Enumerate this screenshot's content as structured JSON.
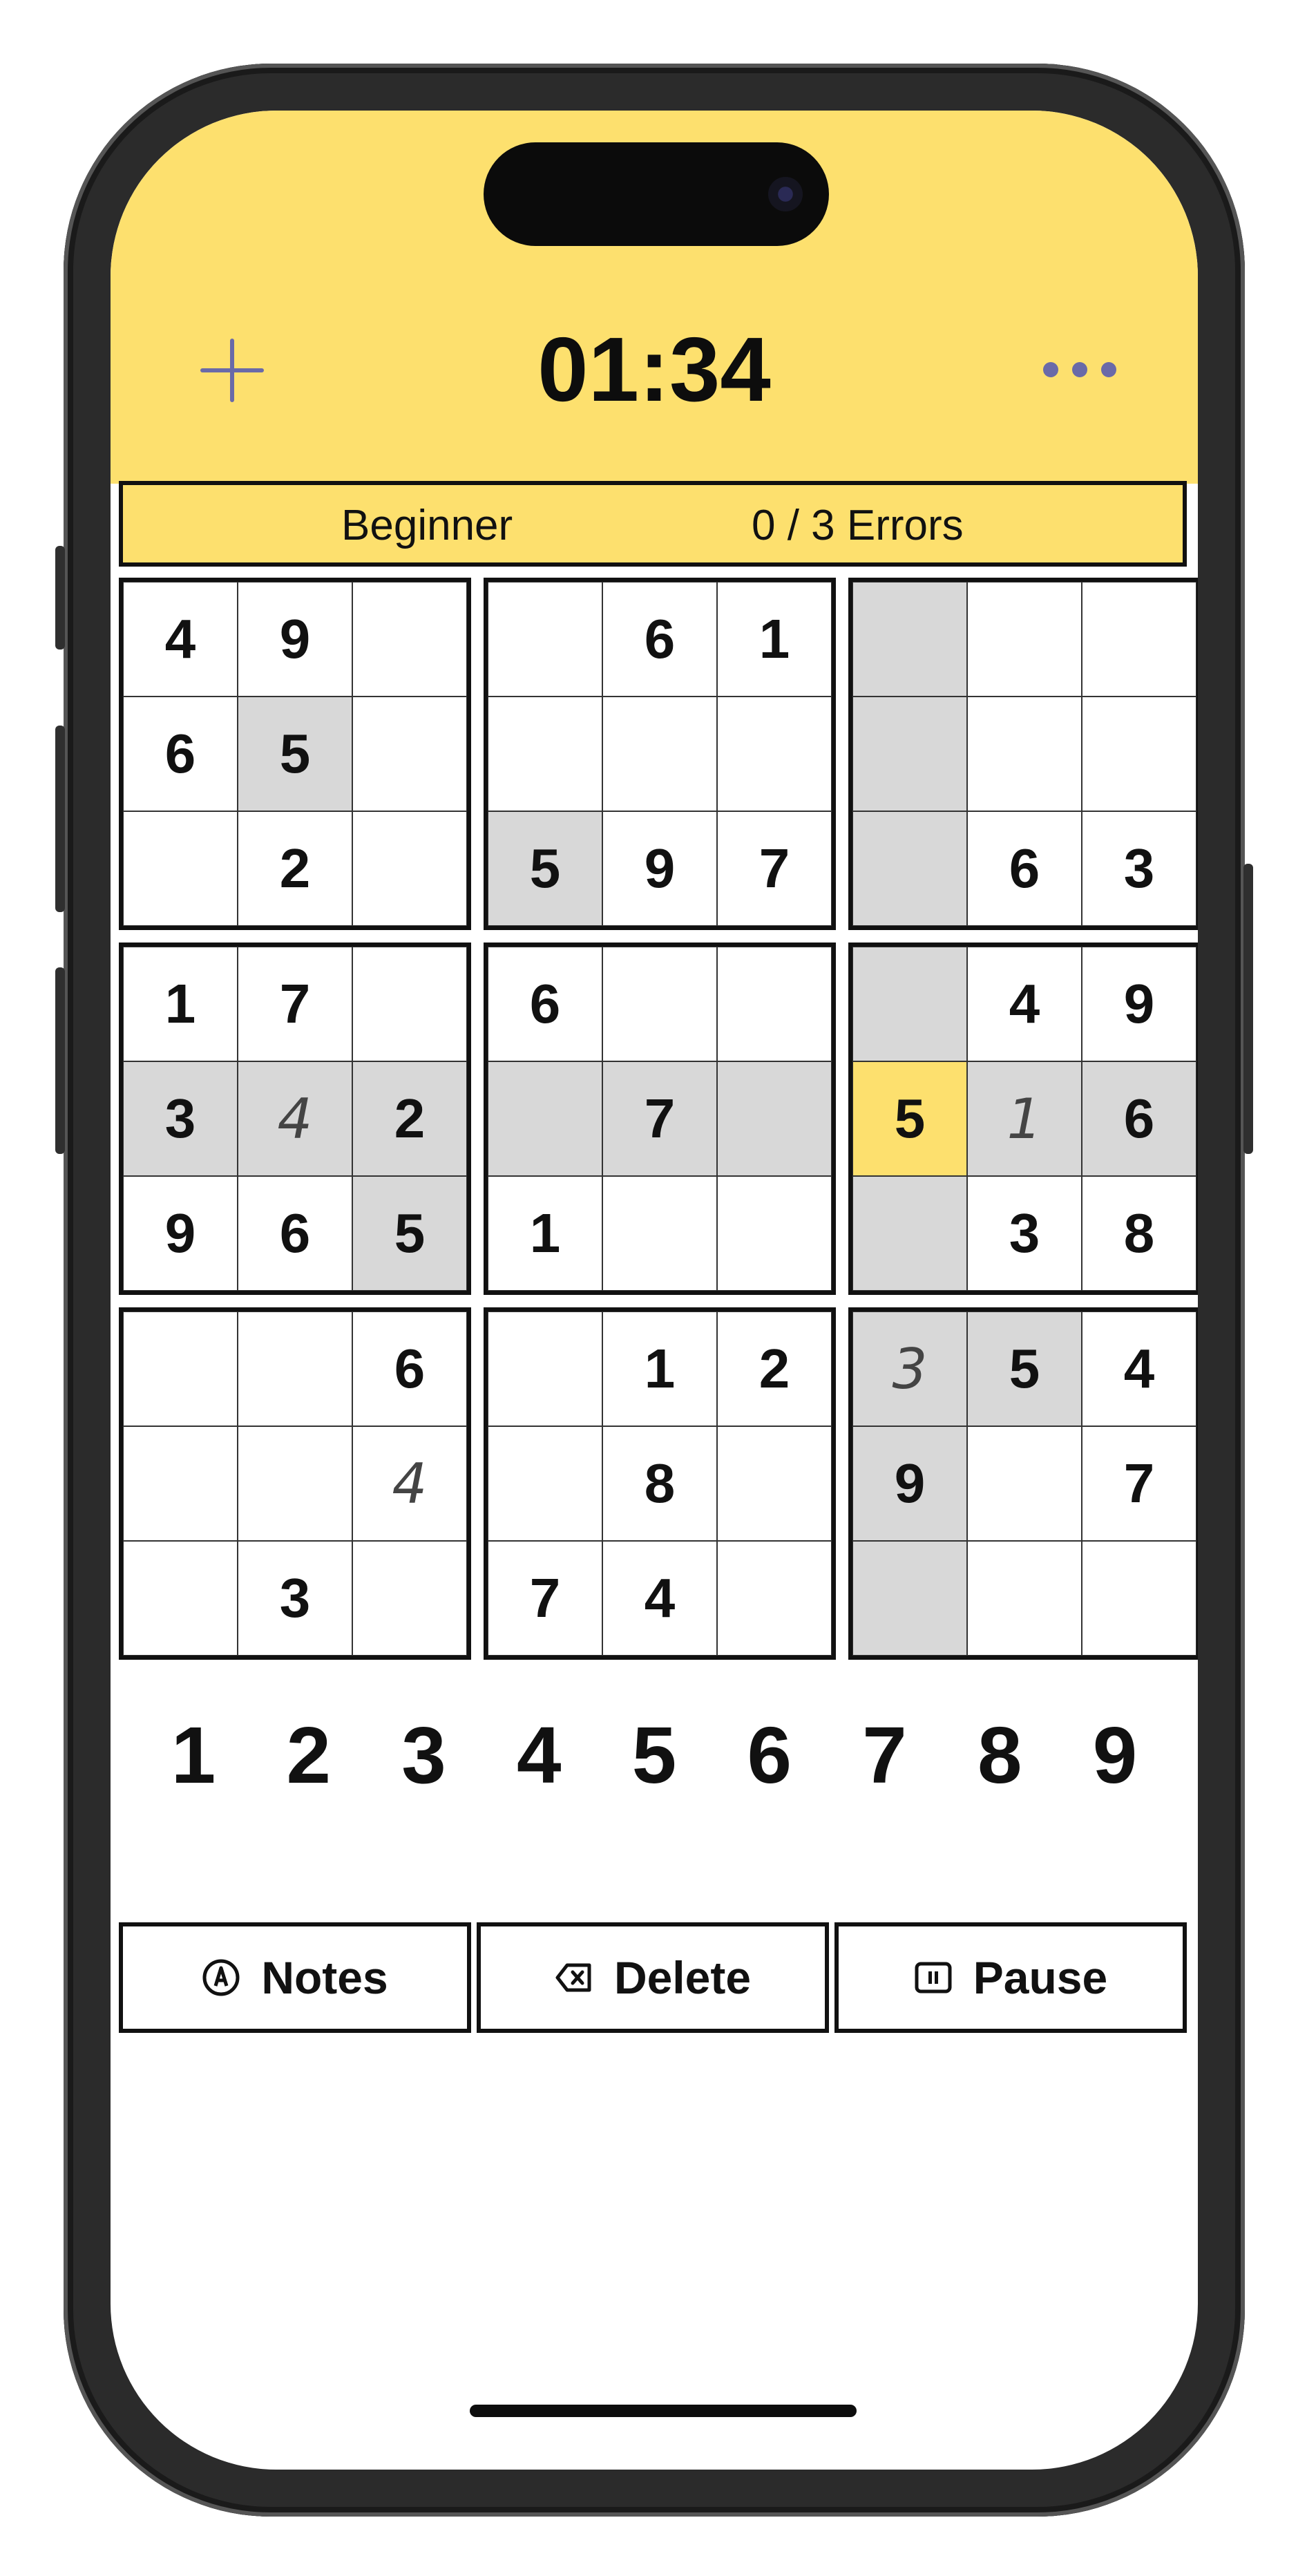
{
  "header": {
    "timer": "01:34",
    "new_game_icon": "plus-icon",
    "more_icon": "ellipsis-icon"
  },
  "status": {
    "difficulty": "Beginner",
    "errors": "0 / 3 Errors"
  },
  "board": {
    "rows": [
      [
        "4",
        "9",
        "",
        "",
        "6",
        "1",
        "",
        "",
        ""
      ],
      [
        "6",
        "5",
        "",
        "",
        "",
        "",
        "",
        "",
        ""
      ],
      [
        "",
        "2",
        "",
        "5",
        "9",
        "7",
        "",
        "6",
        "3"
      ],
      [
        "1",
        "7",
        "",
        "6",
        "",
        "",
        "",
        "4",
        "9"
      ],
      [
        "3",
        "4",
        "2",
        "",
        "7",
        "",
        "5",
        "1",
        "6"
      ],
      [
        "9",
        "6",
        "5",
        "1",
        "",
        "",
        "",
        "3",
        "8"
      ],
      [
        "",
        "",
        "6",
        "",
        "1",
        "2",
        "3",
        "5",
        "4"
      ],
      [
        "",
        "",
        "4",
        "",
        "8",
        "",
        "9",
        "",
        "7"
      ],
      [
        "",
        "3",
        "",
        "7",
        "4",
        "",
        "",
        "",
        ""
      ]
    ],
    "notes_cells": [
      "4,1",
      "4,7",
      "6,6",
      "7,2"
    ],
    "highlighted_cells": [
      "0,6",
      "1,1",
      "1,6",
      "2,3",
      "2,6",
      "3,6",
      "4,0",
      "4,1",
      "4,2",
      "4,3",
      "4,4",
      "4,5",
      "4,7",
      "4,8",
      "5,2",
      "5,6",
      "6,6",
      "6,7",
      "7,6",
      "8,6"
    ],
    "selected_cell": "4,6"
  },
  "numpad": [
    "1",
    "2",
    "3",
    "4",
    "5",
    "6",
    "7",
    "8",
    "9"
  ],
  "actions": {
    "notes": {
      "label": "Notes",
      "icon": "pencil-circle-icon"
    },
    "delete": {
      "label": "Delete",
      "icon": "delete-backspace-icon"
    },
    "pause": {
      "label": "Pause",
      "icon": "pause-icon"
    }
  },
  "colors": {
    "header_bg": "#fde06e",
    "selected_cell": "#fde06e",
    "highlight_cell": "#d8d8d8",
    "accent_icon": "#6a6aa8"
  }
}
